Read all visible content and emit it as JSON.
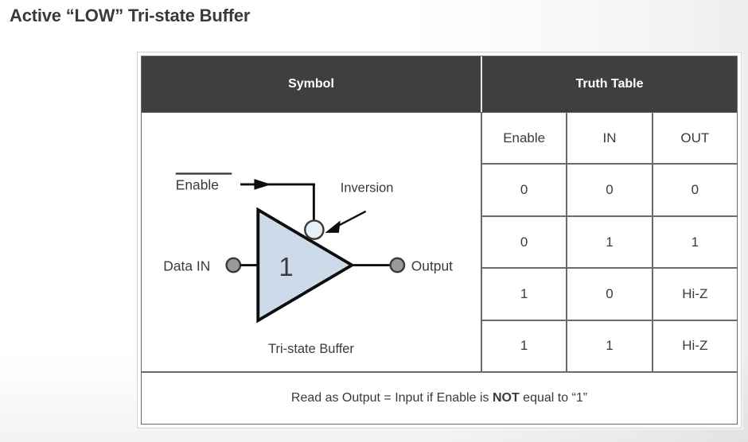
{
  "page": {
    "title": "Active “LOW” Tri-state Buffer",
    "background": "#ffffff",
    "title_color": "#3a3a3c"
  },
  "figure": {
    "header": {
      "symbol_label": "Symbol",
      "truth_label": "Truth Table",
      "background": "#3f3f41",
      "text_color": "#ffffff"
    },
    "symbol": {
      "enable_label": "Enable",
      "enable_overline": true,
      "data_in_label": "Data IN",
      "output_label": "Output",
      "inversion_label": "Inversion",
      "gate_glyph": "1",
      "gate_caption": "Tri-state Buffer",
      "gate_fill": "#ccdaea",
      "gate_stroke": "#0d0d0d",
      "glyph_color": "#2f6fc0",
      "terminal_fill": "#9a9a9a",
      "terminal_stroke": "#3a3a3c",
      "bubble_fill": "#e6eef6"
    },
    "truth_table": {
      "columns": [
        "Enable",
        "IN",
        "OUT"
      ],
      "rows": [
        [
          "0",
          "0",
          "0"
        ],
        [
          "0",
          "1",
          "1"
        ],
        [
          "1",
          "0",
          "Hi-Z"
        ],
        [
          "1",
          "1",
          "Hi-Z"
        ]
      ]
    },
    "footer": {
      "prefix": "Read as Output = Input if Enable is ",
      "emphasis": "NOT",
      "suffix": " equal to “1”"
    }
  }
}
